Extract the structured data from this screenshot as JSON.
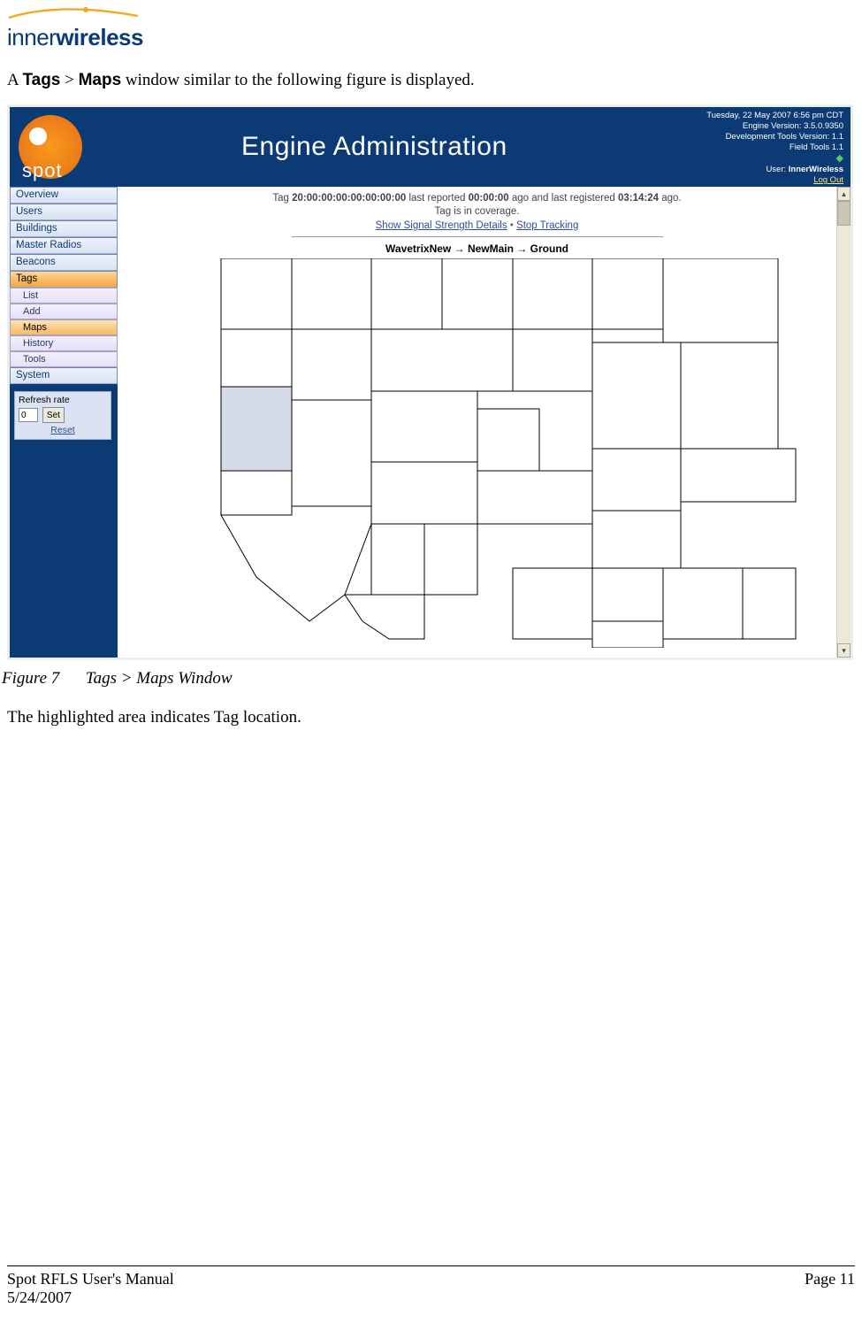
{
  "page": {
    "logo_inner": "inner",
    "logo_wireless": "wireless",
    "intro_prefix": "A ",
    "intro_tags": "Tags",
    "intro_gt": " > ",
    "intro_maps": "Maps",
    "intro_suffix": " window similar to the following figure is displayed.",
    "figure_num": "Figure 7",
    "figure_title": "Tags > Maps Window",
    "body2": "The highlighted area indicates Tag location.",
    "footer_title": "Spot RFLS User's Manual",
    "footer_date": "5/24/2007",
    "footer_page": "Page 11"
  },
  "app": {
    "title": "Engine Administration",
    "header_right": {
      "datetime": "Tuesday, 22 May 2007 6:56 pm CDT",
      "engine_ver": "Engine Version: 3.5.0.9350",
      "dev_tools_ver": "Development Tools Version: 1.1",
      "field_tools": "Field Tools 1.1",
      "user_label": "User: ",
      "user_name": "InnerWireless",
      "logout": "Log Out"
    },
    "sidebar": {
      "items": [
        {
          "label": "Overview"
        },
        {
          "label": "Users"
        },
        {
          "label": "Buildings"
        },
        {
          "label": "Master Radios"
        },
        {
          "label": "Beacons"
        },
        {
          "label": "Tags"
        },
        {
          "label": "System"
        }
      ],
      "tags_sub": [
        {
          "label": "List"
        },
        {
          "label": "Add"
        },
        {
          "label": "Maps"
        },
        {
          "label": "History"
        },
        {
          "label": "Tools"
        }
      ],
      "refresh": {
        "title": "Refresh rate",
        "value": "0",
        "set": "Set",
        "reset": "Reset"
      }
    },
    "main": {
      "status_line1_prefix": "Tag ",
      "tag_id": "20:00:00:00:00:00:00:00",
      "status_line1_mid": " last reported ",
      "reported": "00:00:00",
      "status_line1_mid2": " ago and last registered ",
      "registered": "03:14:24",
      "status_line1_suffix": " ago.",
      "status_line2": "Tag is in coverage.",
      "link_signal": "Show Signal Strength Details",
      "link_stop": "Stop Tracking",
      "bc_a": "WavetrixNew",
      "bc_b": "NewMain",
      "bc_c": "Ground"
    }
  }
}
